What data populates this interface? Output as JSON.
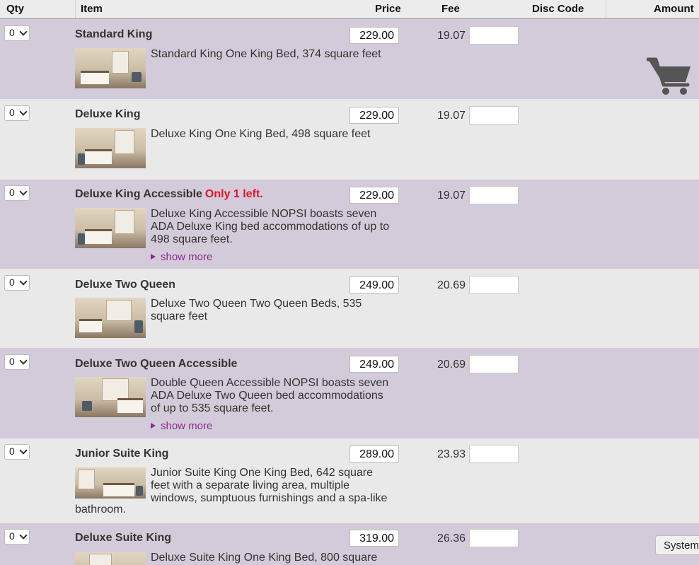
{
  "columns": {
    "qty": "Qty",
    "item": "Item",
    "price": "Price",
    "fee": "Fee",
    "disc_code": "Disc Code",
    "amount": "Amount"
  },
  "rows": [
    {
      "qty": "0",
      "name": "Standard King",
      "price": "229.00",
      "fee": "19.07",
      "description": "Standard King One King Bed, 374 square feet"
    },
    {
      "qty": "0",
      "name": "Deluxe King",
      "price": "229.00",
      "fee": "19.07",
      "description": "Deluxe King One King Bed, 498 square feet"
    },
    {
      "qty": "0",
      "name": "Deluxe King Accessible",
      "availability": "Only 1 left.",
      "price": "229.00",
      "fee": "19.07",
      "description": "Deluxe King Accessible NOPSI boasts seven ADA Deluxe King bed accommodations of up to 498 square feet.",
      "show_more": "show more"
    },
    {
      "qty": "0",
      "name": "Deluxe Two Queen",
      "price": "249.00",
      "fee": "20.69",
      "description": "Deluxe Two Queen Two Queen Beds, 535 square feet"
    },
    {
      "qty": "0",
      "name": "Deluxe Two Queen Accessible",
      "price": "249.00",
      "fee": "20.69",
      "description": "Double Queen Accessible NOPSI boasts seven ADA Deluxe Two Queen bed accommodations of up to 535 square feet.",
      "show_more": "show more"
    },
    {
      "qty": "0",
      "name": "Junior Suite King",
      "price": "289.00",
      "fee": "23.93",
      "description_lines": [
        "Junior Suite King One King Bed, 642 square",
        "feet with a separate living area, multiple",
        "windows, sumptuous furnishings and a spa-like",
        "bathroom."
      ]
    },
    {
      "qty": "0",
      "name": "Deluxe Suite King",
      "price": "319.00",
      "fee": "26.36",
      "description": "Deluxe Suite King One King Bed, 800 square"
    }
  ],
  "cart_icon": "shopping-cart-icon",
  "system_button": "System",
  "colors": {
    "row_purple": "#d3cbd9",
    "row_gray": "#e9e9e9",
    "availability": "#e0132b",
    "link": "#8b2a8f"
  }
}
